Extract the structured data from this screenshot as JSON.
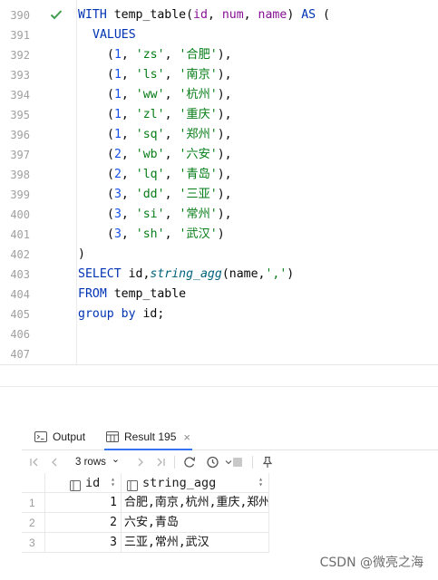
{
  "editor": {
    "lines": [
      {
        "n": "390",
        "check": true
      },
      {
        "n": "391"
      },
      {
        "n": "392"
      },
      {
        "n": "393"
      },
      {
        "n": "394"
      },
      {
        "n": "395"
      },
      {
        "n": "396"
      },
      {
        "n": "397"
      },
      {
        "n": "398"
      },
      {
        "n": "399"
      },
      {
        "n": "400"
      },
      {
        "n": "401"
      },
      {
        "n": "402"
      },
      {
        "n": "403"
      },
      {
        "n": "404"
      },
      {
        "n": "405"
      },
      {
        "n": "406"
      },
      {
        "n": "407"
      }
    ],
    "code": {
      "l390": {
        "kw": "WITH",
        "a": " temp_table(",
        "p1": "id",
        "c1": ", ",
        "p2": "num",
        "c2": ", ",
        "p3": "name",
        "b": ") ",
        "kw2": "AS",
        "e": " ("
      },
      "l391": {
        "kw": "VALUES"
      },
      "values": [
        {
          "num": "1",
          "s1": "'zs'",
          "s2": "'合肥'",
          "end": "),"
        },
        {
          "num": "1",
          "s1": "'ls'",
          "s2": "'南京'",
          "end": "),"
        },
        {
          "num": "1",
          "s1": "'ww'",
          "s2": "'杭州'",
          "end": "),"
        },
        {
          "num": "1",
          "s1": "'zl'",
          "s2": "'重庆'",
          "end": "),"
        },
        {
          "num": "1",
          "s1": "'sq'",
          "s2": "'郑州'",
          "end": "),"
        },
        {
          "num": "2",
          "s1": "'wb'",
          "s2": "'六安'",
          "end": "),"
        },
        {
          "num": "2",
          "s1": "'lq'",
          "s2": "'青岛'",
          "end": "),"
        },
        {
          "num": "3",
          "s1": "'dd'",
          "s2": "'三亚'",
          "end": "),"
        },
        {
          "num": "3",
          "s1": "'si'",
          "s2": "'常州'",
          "end": "),"
        },
        {
          "num": "3",
          "s1": "'sh'",
          "s2": "'武汉'",
          "end": ")"
        }
      ],
      "l402": ")",
      "l403": {
        "kw": "SELECT",
        "a": " id,",
        "fn": "string_agg",
        "b": "(name,",
        "s": "','",
        "e": ")"
      },
      "l404": {
        "kw": "FROM",
        "a": " temp_table"
      },
      "l405": {
        "kw": "group by",
        "a": " id;"
      }
    }
  },
  "panel": {
    "tabs": [
      {
        "label": "Output",
        "icon": "console-icon"
      },
      {
        "label": "Result 195",
        "icon": "table-icon",
        "active": true,
        "close": "×"
      }
    ],
    "toolbar": {
      "rows_label": "3 rows",
      "rows_chevron": "⌄"
    },
    "grid": {
      "columns": [
        {
          "name": "id"
        },
        {
          "name": "string_agg"
        }
      ],
      "rows": [
        {
          "n": "1",
          "id": "1",
          "agg": "合肥,南京,杭州,重庆,郑州"
        },
        {
          "n": "2",
          "id": "2",
          "agg": "六安,青岛"
        },
        {
          "n": "3",
          "id": "3",
          "agg": "三亚,常州,武汉"
        }
      ]
    }
  },
  "watermark": "CSDN @微亮之海",
  "colors": {
    "keyword": "#0033b3",
    "string": "#067d17",
    "number": "#1750eb",
    "function": "#00627a",
    "accent": "#3574f0",
    "check": "#3e9c4b"
  }
}
